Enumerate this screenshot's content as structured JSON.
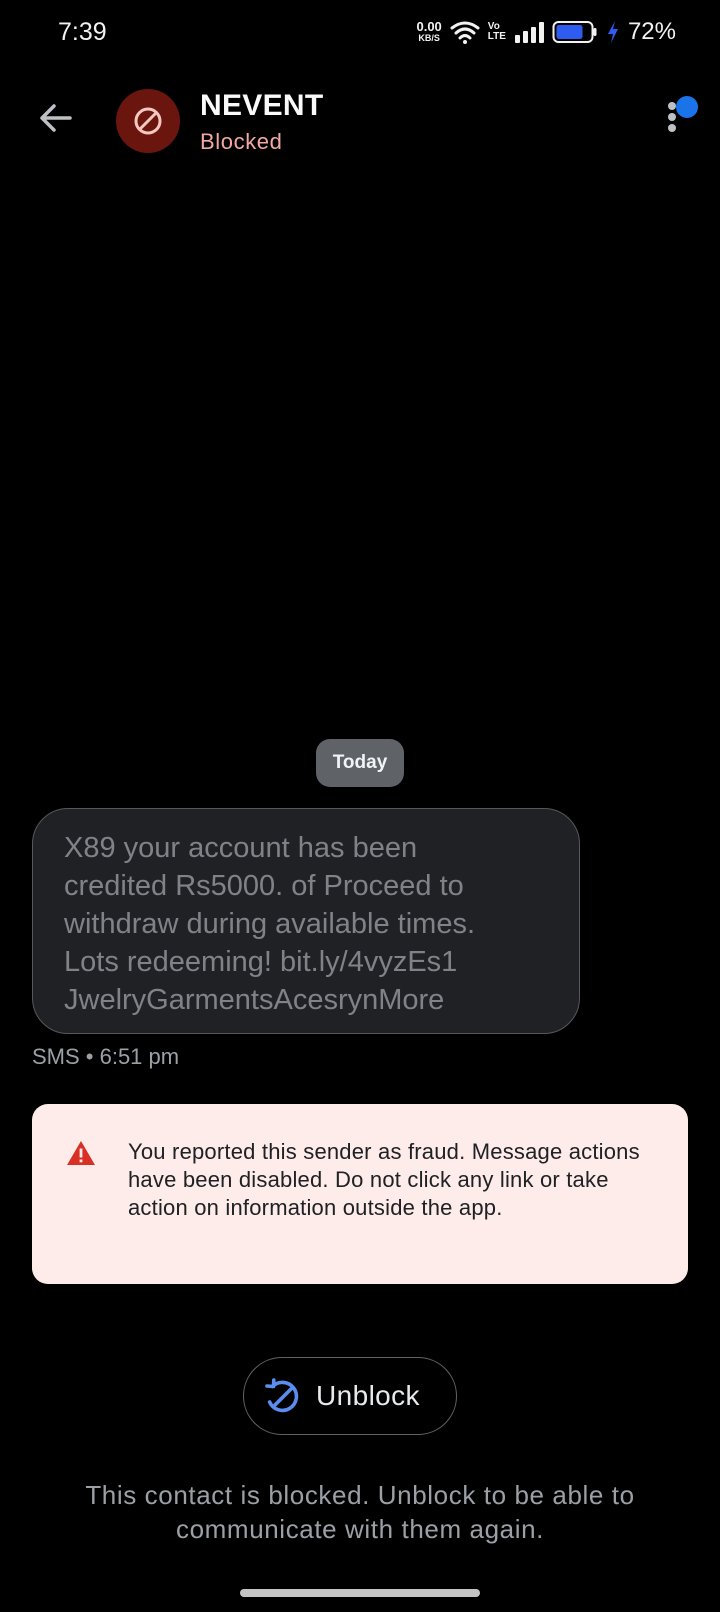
{
  "status_bar": {
    "time": "7:39",
    "net_speed_value": "0.00",
    "net_speed_unit": "KB/S",
    "volte_top": "Vo",
    "volte_bottom": "LTE",
    "battery_percent": "72%",
    "icons": [
      "wifi-icon",
      "signal-icon",
      "battery-icon",
      "charging-icon"
    ]
  },
  "header": {
    "contact_name": "NEVENT",
    "status": "Blocked",
    "back_icon": "arrow-left-icon",
    "avatar_icon": "blocked-icon",
    "menu_icon": "more-vertical-icon"
  },
  "conversation": {
    "date_chip": "Today",
    "message": {
      "lines": [
        "X89 your account has been",
        "credited Rs5000. of Proceed to",
        "withdraw during available times.",
        "Lots redeeming! bit.ly/4vyzEs1",
        "JwelryGarmentsAcesrynMore"
      ],
      "meta": "SMS • 6:51 pm"
    }
  },
  "fraud_warning": {
    "icon": "warning-triangle-icon",
    "text": "You reported this sender as fraud. Message actions have been disabled. Do not click any link or take action on information outside the app."
  },
  "unblock": {
    "label": "Unblock",
    "icon": "unblock-icon"
  },
  "blocked_note": "This contact is blocked. Unblock to be able to communicate with them again.",
  "colors": {
    "background": "#000000",
    "avatar_bg": "#6b150f",
    "blocked_status": "#f3a9a2",
    "accent_blue": "#1a73e8",
    "warning_bg": "#fdecea",
    "warning_icon": "#d93025"
  }
}
